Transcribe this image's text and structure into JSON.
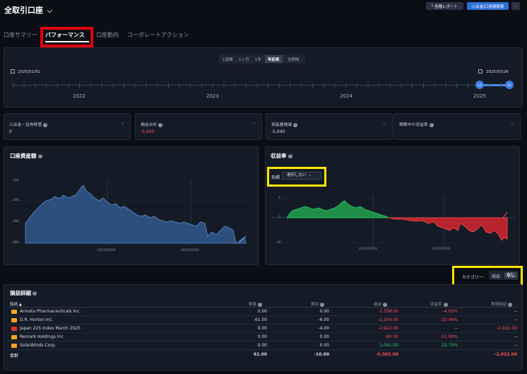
{
  "header": {
    "title": "全取引口座",
    "report_button": "各種レポート",
    "deposit_button": "入出金/口座間振替",
    "more_button": "···"
  },
  "tabs": [
    "口座サマリー",
    "パフォーマンス",
    "口座動向",
    "コーポレートアクション"
  ],
  "periods": [
    "1週間",
    "1ヶ月",
    "1年",
    "年初来",
    "全期間"
  ],
  "timeline": {
    "start": "2025/01/01",
    "end": "2025/03/26",
    "years": [
      "2022",
      "2023",
      "2024",
      "2025"
    ],
    "handle_start": "1/1",
    "handle_end": "3/1"
  },
  "summary": [
    {
      "label": "入出金・証券移管",
      "value": "0",
      "color": "#d7dbe2"
    },
    {
      "label": "損益合計",
      "value": "-5,940",
      "color": "#ff4d57"
    },
    {
      "label": "資産額増減",
      "value": "-5,940",
      "color": "#d7dbe2"
    },
    {
      "label": "期間中の収益率",
      "value": "",
      "color": "#d7dbe2"
    }
  ],
  "asset_chart": {
    "title": "口座資産額",
    "yticks": [
      "51K",
      "50K",
      "49K",
      "48K"
    ],
    "xticks": [
      "2025/02/01",
      "2025/03/01"
    ]
  },
  "return_chart": {
    "title": "収益率",
    "indicator_label": "指標",
    "indicator_select": "選択しない",
    "yticks": [
      "5",
      "0",
      "-5",
      "-10"
    ],
    "xticks": [
      "2025/02/01",
      "2025/03/01"
    ]
  },
  "category": {
    "label": "カテゴリー:",
    "options": [
      "商品",
      "なし"
    ]
  },
  "pl_table": {
    "title": "損益詳細",
    "headers": [
      "銘柄 ▲",
      "数量",
      "費用",
      "損益",
      "収益率",
      "実現損益"
    ],
    "rows": [
      {
        "name": "Armata Pharmaceuticals Inc.",
        "qty": "0.00",
        "cost": "0.00",
        "pl": "-1,358.00",
        "ret": "-4.05%",
        "realized": "--",
        "icon_color": "#f5a623",
        "pl_color": "#ff4d57",
        "ret_color": "#ff4d57",
        "realized_color": "#d7dbe2"
      },
      {
        "name": "D.R. Horton Inc.",
        "qty": "61.00",
        "cost": "-6.00",
        "pl": "-2,204.00",
        "ret": "-10.46%",
        "realized": "--",
        "icon_color": "#f5a623",
        "pl_color": "#ff4d57",
        "ret_color": "#ff4d57",
        "realized_color": "#d7dbe2"
      },
      {
        "name": "Japan 225 Index March 2025",
        "qty": "0.00",
        "cost": "-4.00",
        "pl": "-2,922.00",
        "ret": "--",
        "realized": "-2,922.00",
        "icon_color": "#d9342b",
        "pl_color": "#ff4d57",
        "ret_color": "#d7dbe2",
        "realized_color": "#ff4d57"
      },
      {
        "name": "Remark Holdings Inc.",
        "qty": "0.00",
        "cost": "0.00",
        "pl": "-80.00",
        "ret": "-51.00%",
        "realized": "--",
        "icon_color": "#f5a623",
        "pl_color": "#ff4d57",
        "ret_color": "#ff4d57",
        "realized_color": "#d7dbe2"
      },
      {
        "name": "SolarWinds Corp.",
        "qty": "0.00",
        "cost": "0.00",
        "pl": "1,061.00",
        "ret": "23.75%",
        "realized": "--",
        "icon_color": "#f5a623",
        "pl_color": "#2ecc71",
        "ret_color": "#2ecc71",
        "realized_color": "#d7dbe2"
      }
    ],
    "total": {
      "name": "合計",
      "qty": "61.00",
      "cost": "-10.00",
      "pl": "-5,503.00",
      "ret": "",
      "realized": "-2,922.00"
    }
  }
}
